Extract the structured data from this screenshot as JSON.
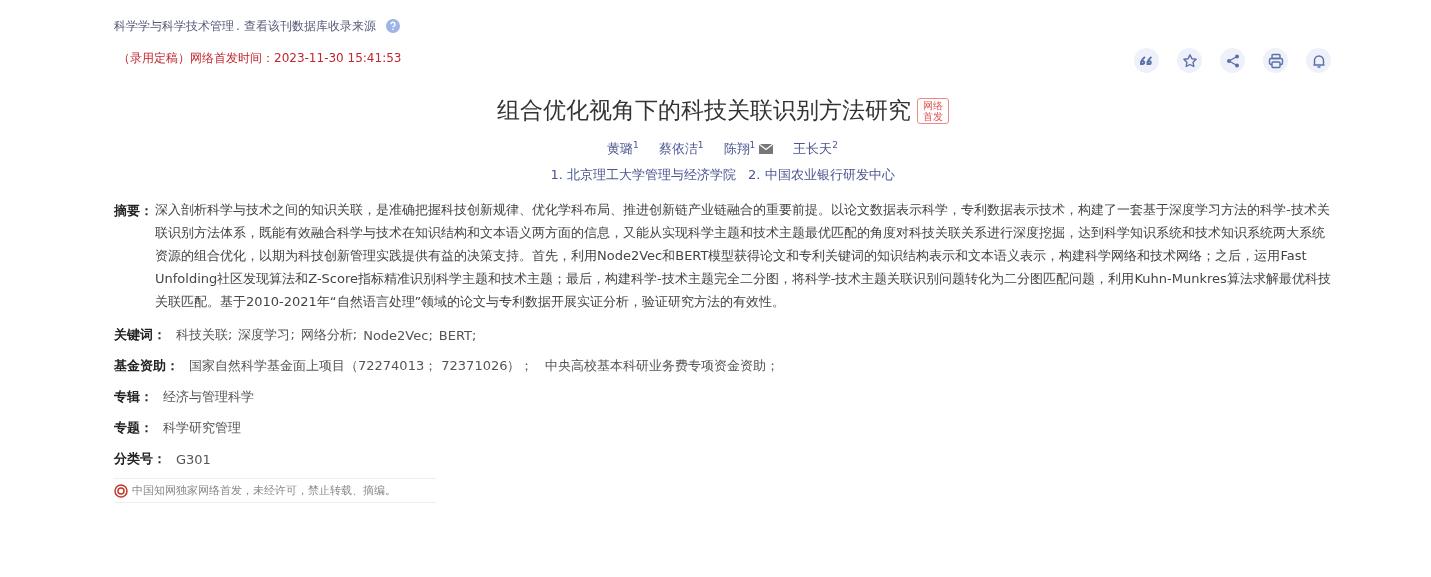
{
  "source": {
    "journal": "科学学与科学技术管理",
    "link": ". 查看该刊数据库收录来源"
  },
  "publish_note": "（录用定稿）网络首发时间：2023-11-30 15:41:53",
  "title": "组合优化视角下的科技关联识别方法研究",
  "title_badge": "网络首发",
  "authors": [
    {
      "name": "黄璐",
      "affiliation": "1",
      "email": false
    },
    {
      "name": "蔡依洁",
      "affiliation": "1",
      "email": false
    },
    {
      "name": "陈翔",
      "affiliation": "1",
      "email": true
    },
    {
      "name": "王长天",
      "affiliation": "2",
      "email": false
    }
  ],
  "affiliations": [
    "1. 北京理工大学管理与经济学院",
    "2. 中国农业银行研发中心"
  ],
  "abstract": {
    "label": "摘要：",
    "text": "深入剖析科学与技术之间的知识关联，是准确把握科技创新规律、优化学科布局、推进创新链产业链融合的重要前提。以论文数据表示科学，专利数据表示技术，构建了一套基于深度学习方法的科学-技术关联识别方法体系，既能有效融合科学与技术在知识结构和文本语义两方面的信息，又能从实现科学主题和技术主题最优匹配的角度对科技关联关系进行深度挖掘，达到科学知识系统和技术知识系统两大系统资源的组合优化，以期为科技创新管理实践提供有益的决策支持。首先，利用Node2Vec和BERT模型获得论文和专利关键词的知识结构表示和文本语义表示，构建科学网络和技术网络；之后，运用Fast Unfolding社区发现算法和Z-Score指标精准识别科学主题和技术主题；最后，构建科学-技术主题完全二分图，将科学-技术主题关联识别问题转化为二分图匹配问题，利用Kuhn-Munkres算法求解最优科技关联匹配。基于2010-2021年“自然语言处理”领域的论文与专利数据开展实证分析，验证研究方法的有效性。"
  },
  "keywords": {
    "label": "关键词：",
    "items": [
      "科技关联;",
      "深度学习;",
      "网络分析;",
      "Node2Vec;",
      "BERT;"
    ]
  },
  "funding": {
    "label": "基金资助：",
    "items": [
      "国家自然科学基金面上项目（72274013； 72371026）；",
      "中央高校基本科研业务费专项资金资助；"
    ]
  },
  "album": {
    "label": "专辑：",
    "value": "经济与管理科学"
  },
  "topic": {
    "label": "专题：",
    "value": "科学研究管理"
  },
  "classification": {
    "label": "分类号：",
    "value": "G301"
  },
  "notice": "中国知网独家网络首发，未经许可，禁止转载、摘编。"
}
